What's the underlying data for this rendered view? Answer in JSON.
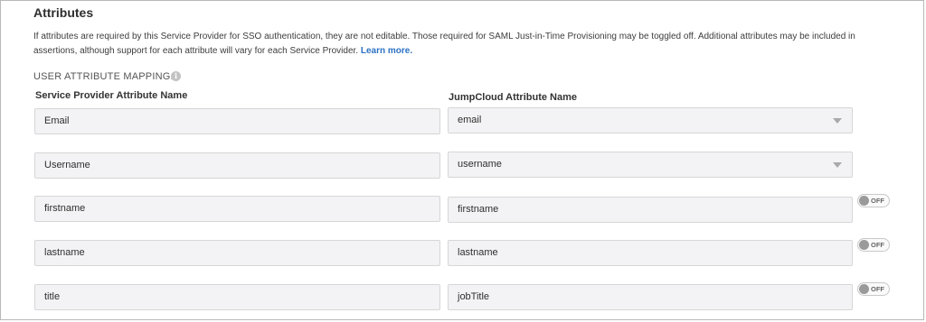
{
  "section": {
    "title": "Attributes",
    "description": "If attributes are required by this Service Provider for SSO authentication, they are not editable. Those required for SAML Just-in-Time Provisioning may be toggled off. Additional attributes may be included in assertions, although support for each attribute will vary for each Service Provider.",
    "learn_more": "Learn more.",
    "mapping_label": "USER ATTRIBUTE MAPPING:",
    "info_glyph": "i"
  },
  "columns": {
    "sp_header": "Service Provider Attribute Name",
    "jc_header": "JumpCloud Attribute Name"
  },
  "rows": [
    {
      "sp": "Email",
      "jc": "email",
      "jc_dropdown": true,
      "toggle": null
    },
    {
      "sp": "Username",
      "jc": "username",
      "jc_dropdown": true,
      "toggle": null
    },
    {
      "sp": "firstname",
      "jc": "firstname",
      "jc_dropdown": false,
      "toggle": "OFF"
    },
    {
      "sp": "lastname",
      "jc": "lastname",
      "jc_dropdown": false,
      "toggle": "OFF"
    },
    {
      "sp": "title",
      "jc": "jobTitle",
      "jc_dropdown": false,
      "toggle": "OFF"
    }
  ],
  "icons": {
    "info": "info-icon",
    "dropdown": "chevron-down-icon",
    "toggle": "toggle-switch-icon"
  }
}
